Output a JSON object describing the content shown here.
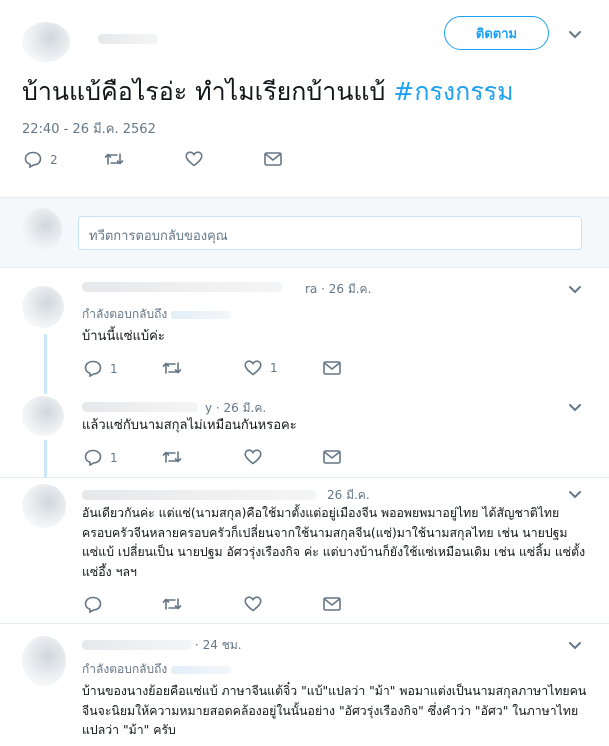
{
  "main_tweet": {
    "follow_label": "ติดตาม",
    "text": "บ้านแบ้คือไรอ่ะ ทำไมเรียกบ้านแบ้ ",
    "hashtag": "#กรงกรรม",
    "timestamp": "22:40 - 26 มี.ค. 2562",
    "reply_count": "2"
  },
  "reply_box": {
    "placeholder": "ทวีตการตอบกลับของคุณ"
  },
  "replies": [
    {
      "handle_tail": "ra · 26 มี.ค.",
      "replying_label": "กำลังตอบกลับถึง",
      "text": "บ้านนี้แซ่แบ้ค่ะ",
      "reply_count": "1",
      "like_count": "1"
    },
    {
      "handle_tail": "y · 26 มี.ค.",
      "text": "แล้วแซ่กับนามสกุลไม่เหมือนกันหรอคะ",
      "reply_count": "1"
    },
    {
      "handle_tail": "26 มี.ค.",
      "text": "อันเดียวกันค่ะ แต่แซ่(นามสกุล)คือใช้มาตั้งแต่อยู่เมืองจีน พออพยพมาอยู่ไทย ได้สัญชาติไทย ครอบครัวจีนหลายครอบครัวก็เปลี่ยนจากใช้นามสกุลจีน(แซ่)มาใช้นามสกุลไทย เช่น นายปฐม แซ่แบ้ เปลี่ยนเป็น นายปฐม อัศวรุ่งเรืองกิจ ค่ะ แต่บางบ้านก็ยังใช้แซ่เหมือนเดิม เช่น แซ่ลิ้ม แซ่ตั้ง แซ่อึ้ง ฯลฯ"
    },
    {
      "handle_tail": "· 24 ชม.",
      "replying_label": "กำลังตอบกลับถึง",
      "text": "บ้านของนางย้อยคือแซ่แบ้ ภาษาจีนแต้จิ๋ว \"แบ้\"แปลว่า \"ม้า\" พอมาแต่งเป็นนามสกุลภาษาไทยคนจีนจะนิยมให้ความหมายสอดคล้องอยู่ในนั้นอย่าง \"อัศวรุ่งเรืองกิจ\" ซึ่งคำว่า \"อัศว\" ในภาษาไทยแปลว่า \"ม้า\" ครับ"
    }
  ],
  "icons": {
    "reply": "reply-icon",
    "retweet": "retweet-icon",
    "like": "heart-icon",
    "dm": "envelope-icon",
    "more": "chevron-down-icon"
  },
  "colors": {
    "accent": "#1da1f2",
    "muted": "#657786"
  }
}
